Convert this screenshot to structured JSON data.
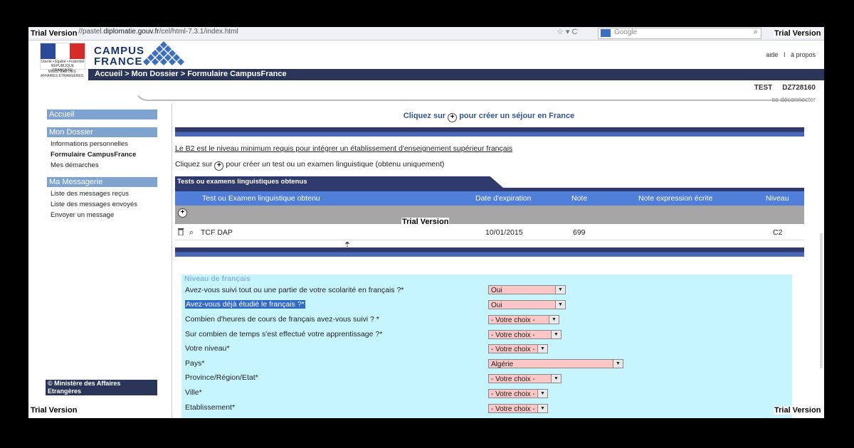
{
  "browser": {
    "url_prefix": "...//pastel.",
    "url_domain": "diplomatie.gouv.fr",
    "url_path": "/cel/html-7.3.1/index.html",
    "search_placeholder": "Google"
  },
  "watermark": "Trial Version",
  "header": {
    "logo_fr_text": "Liberté • Égalité • Fraternité RÉPUBLIQUE FRANÇAISE",
    "ministere_text": "MINISTÈRE DES AFFAIRES ÉTRANGÈRES",
    "brand_line1": "CAMPUS",
    "brand_line2": "FRANCE",
    "link_help": "aide",
    "link_sep": "I",
    "link_about": "à propos",
    "breadcrumb": "Accueil > Mon Dossier > Formulaire CampusFrance",
    "user_label": "TEST",
    "user_id": "DZ728160",
    "logout": "se déconnecter"
  },
  "sidebar": {
    "home": "Accueil",
    "dossier_title": "Mon Dossier",
    "dossier_items": [
      "Informations personnelles",
      "Formulaire CampusFrance",
      "Mes démarches"
    ],
    "messagerie_title": "Ma Messagerie",
    "messagerie_items": [
      "Liste des messages reçus",
      "Liste des messages envoyés",
      "Envoyer un message"
    ],
    "copyright_line1": "© Ministère des Affaires",
    "copyright_line2": "Etrangères"
  },
  "main": {
    "cliquez_sur": "Cliquez sur",
    "creer_sejour": "pour créer un séjour en France",
    "b2_notice": "Le B2 est le niveau minimum requis pour intégrer un établissement d'enseignement supérieur français",
    "creer_test": "pour créer un test ou un examen linguistique (obtenu uniquement)",
    "tab_title": "Tests ou examens linguistiques obtenus",
    "columns": [
      "Test ou Examen linguistique obtenu",
      "Date d'expiration",
      "Note",
      "Note expression écrite",
      "Niveau"
    ],
    "rows": [
      {
        "test": "TCF DAP",
        "expiration": "10/01/2015",
        "note": "699",
        "note_ecrite": "",
        "niveau": "C2"
      }
    ]
  },
  "form": {
    "legend": "Niveau de français",
    "fields": [
      {
        "label": "Avez-vous suivi tout ou une partie de votre scolarité en français ?*",
        "value": "Oui"
      },
      {
        "label": "Avez-vous déjà étudié le français ?*",
        "value": "Oui"
      },
      {
        "label": "Combien d'heures de cours de français avez-vous suivi ? *",
        "value": "- Votre choix -"
      },
      {
        "label": "Sur combien de temps s'est effectué votre apprentissage ?*",
        "value": "- Votre choix -"
      },
      {
        "label": "Votre niveau*",
        "value": "- Votre choix -"
      },
      {
        "label": "Pays*",
        "value": "Algérie"
      },
      {
        "label": "Province/Région/Etat*",
        "value": "- Votre choix -"
      },
      {
        "label": "Ville*",
        "value": "- Votre choix -"
      },
      {
        "label": "Etablissement*",
        "value": "- Votre choix -"
      }
    ]
  },
  "colors": {
    "navy": "#2b3557",
    "table_header": "#4f7fd8",
    "form_bg": "#c7f5ff",
    "select_bg": "#fbc6c6",
    "sidebar_head": "#7fa3cf"
  }
}
